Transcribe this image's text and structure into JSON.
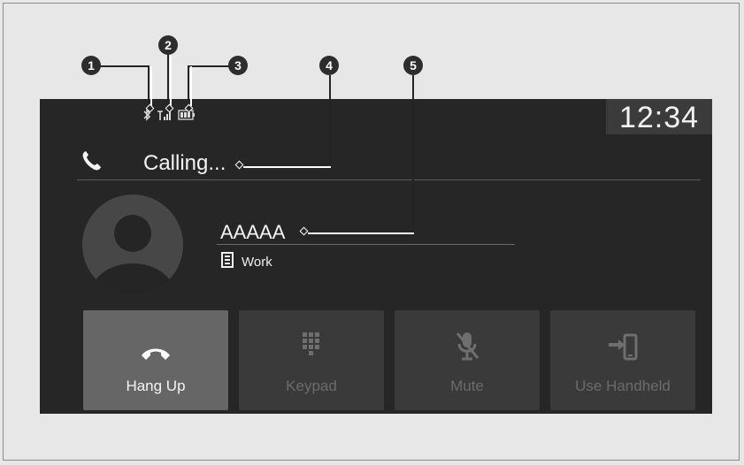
{
  "screen": {
    "clock": "12:34",
    "call_status": "Calling...",
    "contact": {
      "name": "AAAAA",
      "type": "Work"
    },
    "buttons": [
      {
        "label": "Hang Up",
        "icon": "hang-up-icon",
        "enabled": true
      },
      {
        "label": "Keypad",
        "icon": "keypad-icon",
        "enabled": false
      },
      {
        "label": "Mute",
        "icon": "mute-icon",
        "enabled": false
      },
      {
        "label": "Use Handheld",
        "icon": "use-handheld-icon",
        "enabled": false
      }
    ],
    "status_icons": [
      "bluetooth-icon",
      "signal-icon",
      "battery-icon"
    ]
  },
  "callouts": [
    "1",
    "2",
    "3",
    "4",
    "5"
  ],
  "colors": {
    "background": "#e7e7e7",
    "screen": "#262626",
    "button": "#3a3a3a",
    "button_active": "#666666",
    "text": "#f5f5f5"
  }
}
